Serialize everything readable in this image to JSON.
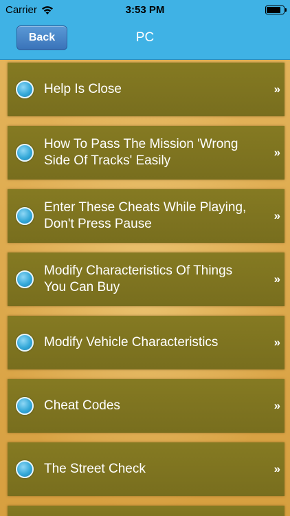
{
  "status_bar": {
    "carrier": "Carrier",
    "time": "3:53 PM"
  },
  "nav": {
    "back_label": "Back",
    "title": "PC"
  },
  "items": [
    {
      "label": "Help Is Close"
    },
    {
      "label": "How To Pass The Mission 'Wrong Side Of Tracks' Easily"
    },
    {
      "label": "Enter These Cheats While Playing, Don't Press Pause"
    },
    {
      "label": "Modify Characteristics Of Things You Can Buy"
    },
    {
      "label": "Modify Vehicle Characteristics"
    },
    {
      "label": "Cheat Codes"
    },
    {
      "label": "The Street Check"
    }
  ],
  "colors": {
    "bar": "#3fb2e5",
    "back_button": "#4a86c8",
    "row": "#7f7420",
    "background": "#d9a74a",
    "bullet": "#35a9d9"
  },
  "icons": {
    "wifi": "wifi-icon",
    "battery": "battery-icon",
    "bullet": "bullet-icon",
    "chevron": "chevron-right-icon"
  }
}
